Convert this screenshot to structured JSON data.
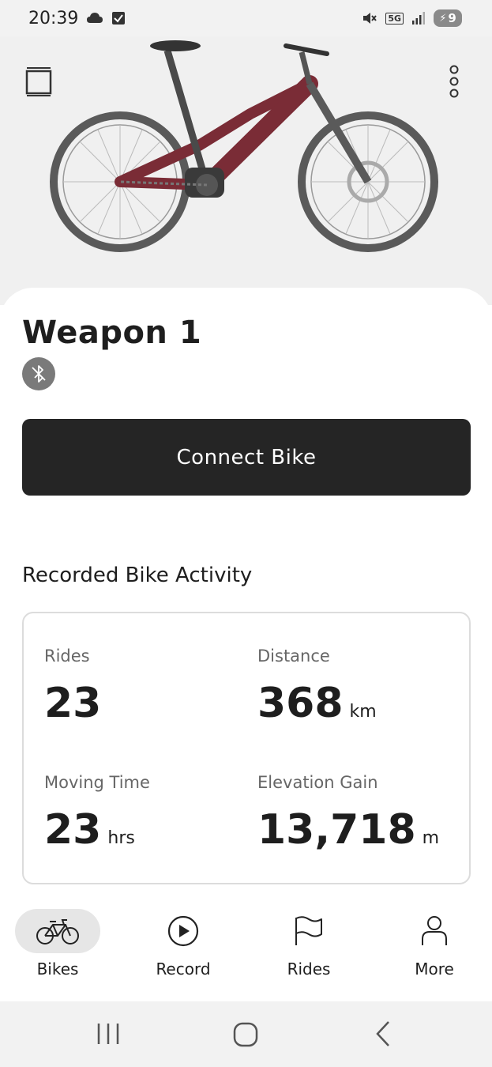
{
  "status_bar": {
    "time": "20:39",
    "network": "5G",
    "battery_level": "9",
    "icons": [
      "cloud-icon",
      "check-box-icon",
      "mute-icon",
      "signal-icon",
      "battery-charging-icon"
    ]
  },
  "hero": {
    "menu_icon": "layers-icon",
    "more_icon": "vertical-dots-icon",
    "bike_image": "red-emtb-bike-image"
  },
  "bike": {
    "name": "Weapon 1",
    "status_icon": "bluetooth-disabled-icon"
  },
  "connect_button": {
    "label": "Connect Bike"
  },
  "activity": {
    "title": "Recorded Bike Activity",
    "stats": {
      "rides": {
        "label": "Rides",
        "value": "23",
        "unit": ""
      },
      "distance": {
        "label": "Distance",
        "value": "368",
        "unit": "km"
      },
      "moving_time": {
        "label": "Moving Time",
        "value": "23",
        "unit": "hrs"
      },
      "elevation": {
        "label": "Elevation Gain",
        "value": "13,718",
        "unit": "m"
      }
    }
  },
  "nav": {
    "items": [
      {
        "label": "Bikes",
        "icon": "bike-icon",
        "active": true
      },
      {
        "label": "Record",
        "icon": "play-circle-icon",
        "active": false
      },
      {
        "label": "Rides",
        "icon": "flag-icon",
        "active": false
      },
      {
        "label": "More",
        "icon": "person-icon",
        "active": false
      }
    ]
  },
  "system_nav": {
    "icons": [
      "recents-icon",
      "home-icon",
      "back-icon"
    ]
  },
  "colors": {
    "button_dark": "#252525",
    "bike_frame": "#7a2c36",
    "nav_active_bg": "#e6e6e6"
  }
}
